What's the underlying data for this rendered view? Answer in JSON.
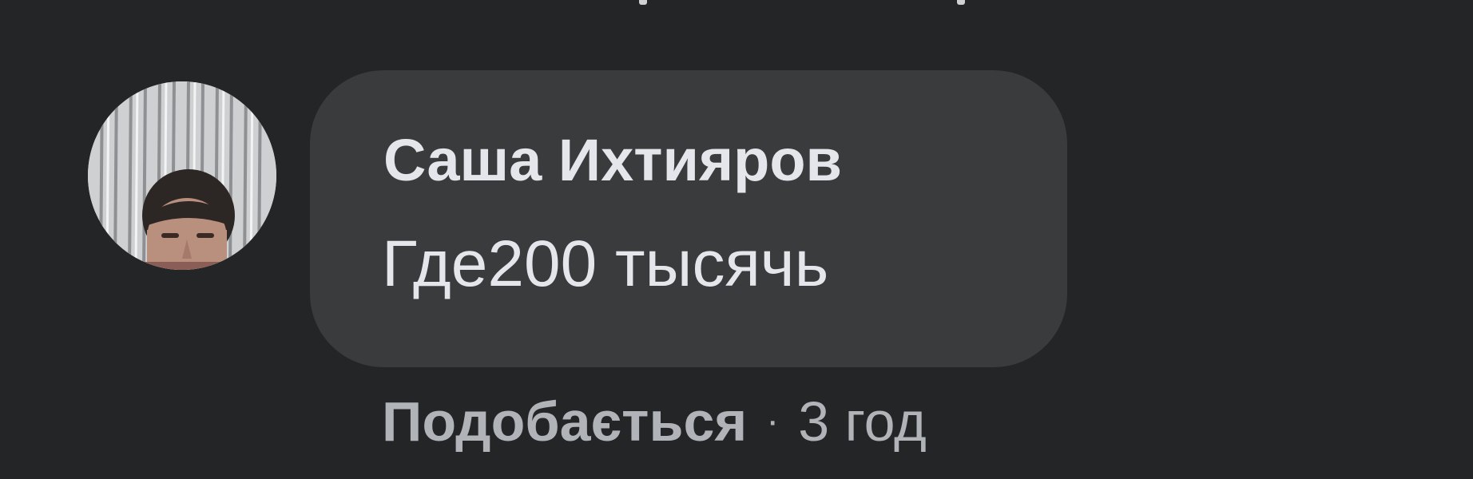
{
  "comment": {
    "author": "Саша Ихтияров",
    "text": "Где200 тысячь",
    "actions": {
      "like_label": "Подобається",
      "separator": "·",
      "timestamp": "3 год"
    },
    "avatar": {
      "icon": "user-avatar-photo"
    }
  },
  "colors": {
    "background": "#242526",
    "bubble": "#3a3b3c",
    "primary_text": "#e4e6eb",
    "secondary_text": "#b0b3b8"
  }
}
